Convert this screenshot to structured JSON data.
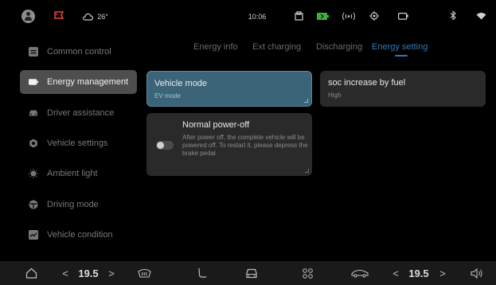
{
  "status_bar": {
    "weather": "26°",
    "time": "10:06",
    "icons": [
      "avatar",
      "flag-icon",
      "cloud-icon",
      "clipboard-icon",
      "battery-icon",
      "signal-icon",
      "target-icon",
      "camera-icon",
      "bluetooth-icon",
      "wifi-icon"
    ],
    "battery_color": "#3fae3f"
  },
  "sidebar": {
    "items": [
      {
        "label": "Common control",
        "icon": "grid-icon",
        "active": false
      },
      {
        "label": "Energy management",
        "icon": "battery-icon",
        "active": true
      },
      {
        "label": "Driver assistance",
        "icon": "car-icon",
        "active": false
      },
      {
        "label": "Vehicle settings",
        "icon": "gear-icon",
        "active": false
      },
      {
        "label": "Ambient light",
        "icon": "bulb-icon",
        "active": false
      },
      {
        "label": "Driving mode",
        "icon": "steering-icon",
        "active": false
      },
      {
        "label": "Vehicle condition",
        "icon": "chart-icon",
        "active": false
      }
    ]
  },
  "tabs": [
    {
      "label": "Energy info",
      "active": false
    },
    {
      "label": "Ext charging",
      "active": false
    },
    {
      "label": "Discharging",
      "active": false
    },
    {
      "label": "Energy setting",
      "active": true
    }
  ],
  "cards": {
    "vehicle_mode": {
      "title": "Vehicle mode",
      "value": "EV mode"
    },
    "soc_increase": {
      "title": "soc increase by fuel",
      "value": "High"
    },
    "power_off": {
      "title": "Normal power-off",
      "description": "After power off, the complete vehicle will be powered off. To restart it, please depress the brake pedal",
      "enabled": false
    }
  },
  "bottom_bar": {
    "left_temp": "19.5",
    "right_temp": "19.5",
    "left_dec": "<",
    "left_inc": ">",
    "right_dec": "<",
    "right_inc": ">",
    "icons": [
      "home-icon",
      "front-defrost-icon",
      "seat-icon",
      "car-front-icon",
      "apps-icon",
      "car-side-icon",
      "volume-icon"
    ]
  },
  "colors": {
    "accent": "#2e7ab6",
    "selected_card": "#3c6479",
    "active_sidebar": "#4e4e4e"
  }
}
